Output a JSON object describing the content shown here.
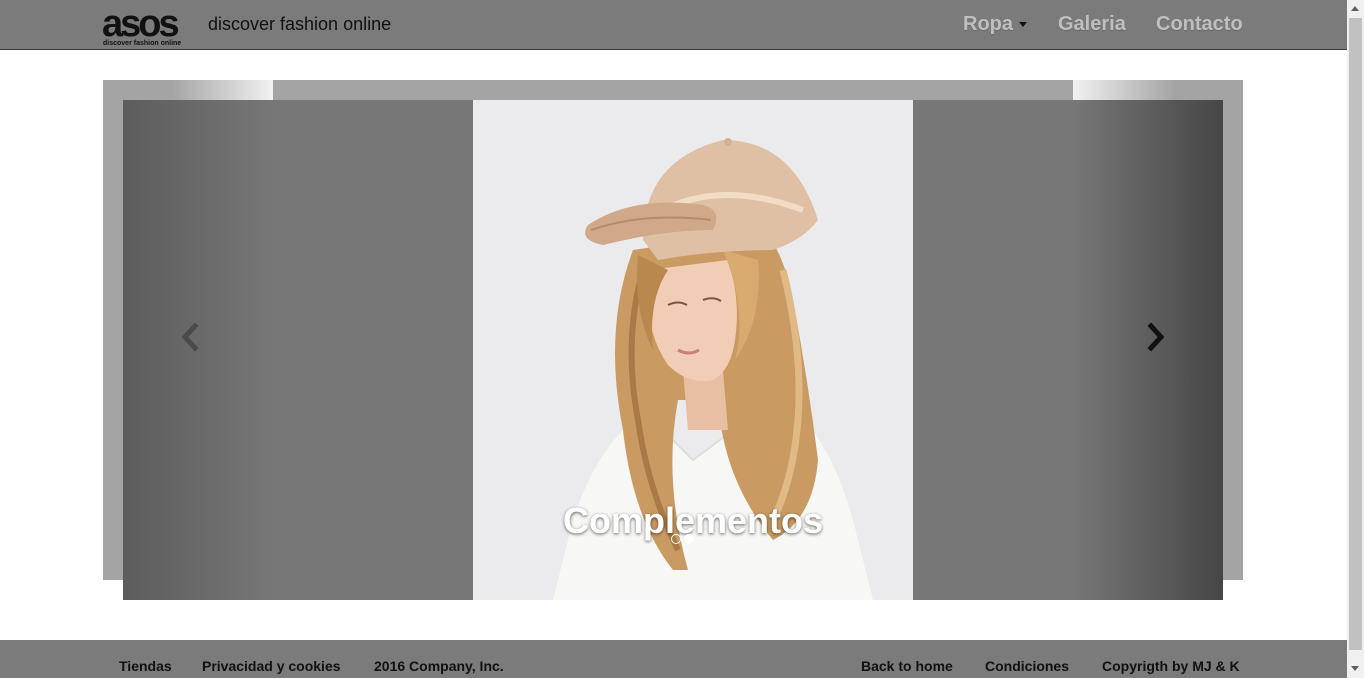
{
  "brand": {
    "logo_text": "asos",
    "logo_subtext": "discover fashion online",
    "tagline": "discover fashion online"
  },
  "nav": {
    "items": [
      {
        "label": "Ropa",
        "has_dropdown": true
      },
      {
        "label": "Galeria"
      },
      {
        "label": "Contacto"
      }
    ]
  },
  "carousel": {
    "caption": "Complementos",
    "active_slide": 2,
    "slide_count": 2,
    "prev_icon": "chevron-left-icon",
    "next_icon": "chevron-right-icon"
  },
  "footer": {
    "left": [
      "Tiendas",
      "Privacidad y cookies",
      "2016 Company, Inc."
    ],
    "right": [
      "Back to home",
      "Condiciones",
      "Copyrigth by MJ & K"
    ]
  },
  "colors": {
    "navbar": "#7b7b7b",
    "nav_text": "#bfbfbf",
    "carousel_bg": "#777777",
    "footer": "#7b7b7b"
  }
}
